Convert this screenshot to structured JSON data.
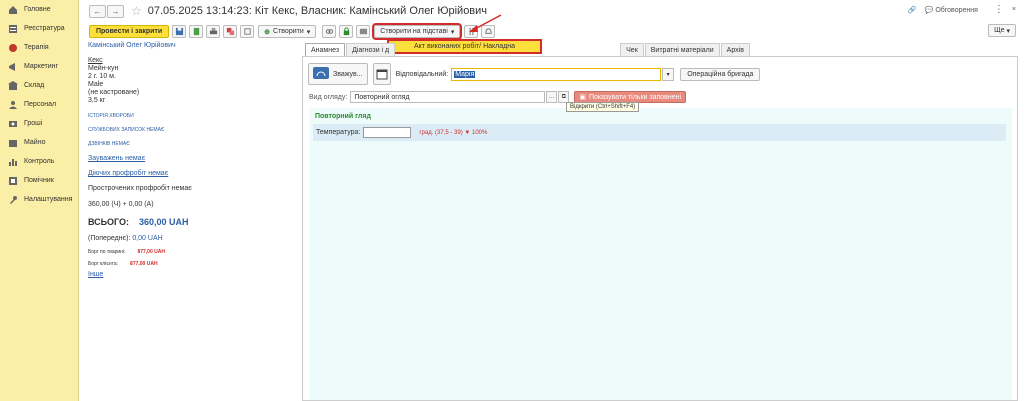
{
  "sidebar": {
    "items": [
      {
        "label": "Головне",
        "icon": "home-icon"
      },
      {
        "label": "Реєстратура",
        "icon": "list-icon"
      },
      {
        "label": "Терапія",
        "icon": "therapy-icon"
      },
      {
        "label": "Маркетинг",
        "icon": "marketing-icon"
      },
      {
        "label": "Склад",
        "icon": "warehouse-icon"
      },
      {
        "label": "Персонал",
        "icon": "staff-icon"
      },
      {
        "label": "Гроші",
        "icon": "money-icon"
      },
      {
        "label": "Майно",
        "icon": "property-icon"
      },
      {
        "label": "Контроль",
        "icon": "chart-icon"
      },
      {
        "label": "Помічник",
        "icon": "helper-icon"
      },
      {
        "label": "Налаштування",
        "icon": "wrench-icon"
      }
    ]
  },
  "header": {
    "back": "←",
    "forward": "→",
    "title": "07.05.2025 13:14:23: Кіт Кекс, Власник: Камінський Олег Юрійович",
    "discussions": "Обговорення",
    "more_dots": "⋮",
    "close": "×"
  },
  "toolbar": {
    "post_close": "Провести і закрити",
    "create_label": "Створити",
    "create_based_on": "Створити на підставі",
    "more": "Ще"
  },
  "dropdown": {
    "item": "Акт виконаних робіт/ Накладна"
  },
  "info": {
    "owner": "Камінський Олег Юрійович",
    "pet_name": "Кекс",
    "breed": "Мейн-кун",
    "age": "2 г. 10 м.",
    "sex": "Male",
    "neutered": "(не кастроване)",
    "weight": "3,5 кг",
    "history": "ІСТОРІЯ ХВОРОБИ",
    "service_notes": "СЛУЖБОВИХ ЗАПИСОК НЕМАЄ",
    "reminders": "ДЗВІНКІВ НЕМАЄ",
    "remarks": "Зауважень немає",
    "active_prevention": "Діючих профробіт немає",
    "overdue_prevention": "Прострочених профробіт немає",
    "balance_line": "360,00 (Ч) + 0,00 (А)",
    "total_label": "ВСЬОГО:",
    "total_value": "360,00 UAH",
    "previous_label": "(Попереднє):",
    "previous_value": "0,00 UAH",
    "debt_owner_label": "Борг по тварині:",
    "debt_owner_value": "877,00 UAH",
    "debt_client_label": "Борг клієнта:",
    "debt_client_value": "877,00 UAH",
    "other": "Інше"
  },
  "tabs": [
    {
      "label": "Анамнез",
      "active": true
    },
    {
      "label": "Діагнози і д",
      "active": false
    },
    {
      "label": "Чек",
      "active": false
    },
    {
      "label": "Витратні матеріали",
      "active": false
    },
    {
      "label": "Архів",
      "active": false
    }
  ],
  "main": {
    "weigh_label": "Зважув...",
    "responsible_label": "Відповідальний:",
    "responsible_value": "Марія",
    "op_team": "Операційна бригада",
    "view_label": "Вид огляду:",
    "view_value": "Повторний огляд",
    "show_filled": "Показувати тільки заповнені",
    "tooltip": "Відкрити  (Ctrl+Shift+F4)",
    "form_title": "Повторний гляд",
    "temp_label": "Температура:",
    "temp_unit": "град.  (37,5 - 39)  ▼ 100%"
  },
  "colors": {
    "sidebar_bg": "#fbeea6",
    "primary_btn": "#fddf3c",
    "annotation_red": "#d32a2a",
    "link_blue": "#2b5ea7",
    "form_bg": "#edfbfb"
  }
}
